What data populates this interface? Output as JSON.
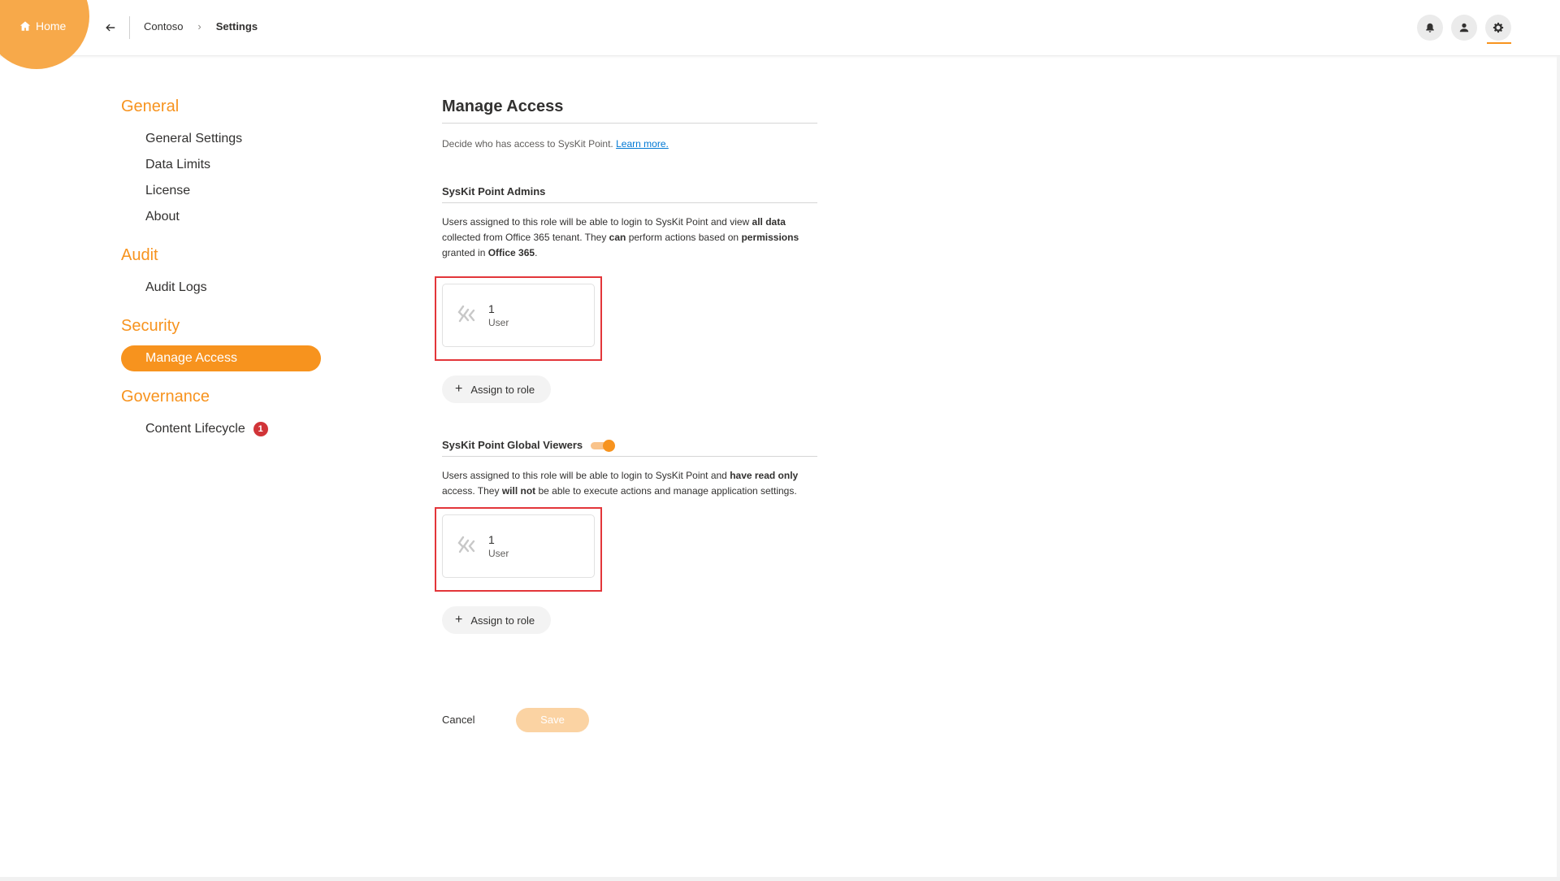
{
  "header": {
    "home_label": "Home",
    "breadcrumb": [
      "Contoso",
      "Settings"
    ],
    "icons": [
      "bell-icon",
      "user-icon",
      "gear-icon"
    ]
  },
  "sidebar": {
    "sections": [
      {
        "title": "General",
        "items": [
          "General Settings",
          "Data Limits",
          "License",
          "About"
        ]
      },
      {
        "title": "Audit",
        "items": [
          "Audit Logs"
        ]
      },
      {
        "title": "Security",
        "items": [
          "Manage Access"
        ]
      },
      {
        "title": "Governance",
        "items": [
          "Content Lifecycle"
        ]
      }
    ],
    "active_item": "Manage Access",
    "content_lifecycle_badge": "1"
  },
  "main": {
    "title": "Manage Access",
    "description": "Decide who has access to SysKit Point.",
    "learn_more": "Learn more.",
    "admins": {
      "title": "SysKit Point Admins",
      "desc_parts": [
        "Users assigned to this role will be able to login to SysKit Point and view ",
        "all data",
        " collected from Office 365 tenant. They ",
        "can",
        " perform actions based on ",
        "permissions",
        " granted in ",
        "Office 365",
        "."
      ],
      "user_count": "1",
      "user_label": "User",
      "assign_label": "Assign to role"
    },
    "viewers": {
      "title": "SysKit Point Global Viewers",
      "toggle_on": true,
      "desc_parts": [
        "Users assigned to this role will be able to login to SysKit Point and ",
        "have read only",
        " access. They ",
        "will not",
        " be able to execute actions and manage application settings."
      ],
      "user_count": "1",
      "user_label": "User",
      "assign_label": "Assign to role"
    },
    "cancel_label": "Cancel",
    "save_label": "Save"
  },
  "colors": {
    "accent": "#f7931e",
    "highlight_border": "#e3363a",
    "badge": "#d13438",
    "link": "#0078d4"
  }
}
